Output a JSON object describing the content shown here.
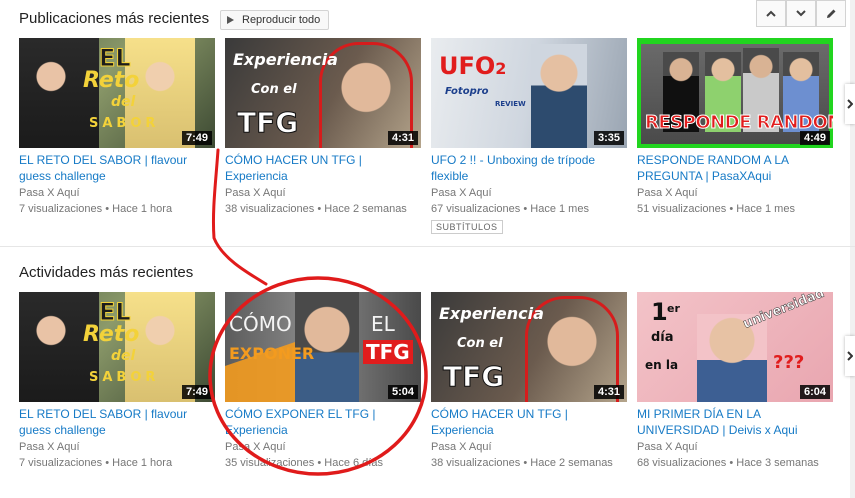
{
  "sections": {
    "recent_uploads": {
      "title": "Publicaciones más recientes",
      "play_all_label": "Reproducir todo"
    },
    "recent_activity": {
      "title": "Actividades más recientes"
    }
  },
  "controls": {
    "up_icon": "chevron-up-icon",
    "down_icon": "chevron-down-icon",
    "edit_icon": "pencil-icon"
  },
  "uploads": [
    {
      "title": "EL RETO DEL SABOR | flavour guess challenge",
      "channel": "Pasa X Aquí",
      "views": "7 visualizaciones",
      "age": "Hace 1 hora",
      "duration": "7:49",
      "thumb_text": [
        "EL",
        "Reto",
        "del",
        "SABOR"
      ]
    },
    {
      "title": "CÓMO HACER UN TFG | Experiencia",
      "channel": "Pasa X Aquí",
      "views": "38 visualizaciones",
      "age": "Hace 2 semanas",
      "duration": "4:31",
      "thumb_text": [
        "Experiencia",
        "Con el",
        "TFG"
      ]
    },
    {
      "title": "UFO 2 !! - Unboxing de trípode flexible",
      "channel": "Pasa X Aquí",
      "views": "67 visualizaciones",
      "age": "Hace 1 mes",
      "duration": "3:35",
      "badge": "SUBTÍTULOS",
      "thumb_text": [
        "UFO",
        "2",
        "Fotopro",
        "REVIEW"
      ]
    },
    {
      "title": "RESPONDE RANDOM A LA PREGUNTA | PasaXAqui",
      "channel": "Pasa X Aquí",
      "views": "51 visualizaciones",
      "age": "Hace 1 mes",
      "duration": "4:49",
      "thumb_text": [
        "RESPONDE RANDOM"
      ]
    }
  ],
  "activity": [
    {
      "title": "EL RETO DEL SABOR | flavour guess challenge",
      "channel": "Pasa X Aquí",
      "views": "7 visualizaciones",
      "age": "Hace 1 hora",
      "duration": "7:49",
      "thumb_text": [
        "EL",
        "Reto",
        "del",
        "SABOR"
      ]
    },
    {
      "title": "CÓMO EXPONER EL TFG | Experiencia",
      "channel": "Pasa X Aquí",
      "views": "35 visualizaciones",
      "age": "Hace 6 días",
      "duration": "5:04",
      "thumb_text": [
        "CÓMO",
        "EL",
        "EXPONER",
        "TFG"
      ]
    },
    {
      "title": "CÓMO HACER UN TFG | Experiencia",
      "channel": "Pasa X Aquí",
      "views": "38 visualizaciones",
      "age": "Hace 2 semanas",
      "duration": "4:31",
      "thumb_text": [
        "Experiencia",
        "Con el",
        "TFG"
      ]
    },
    {
      "title": "MI PRIMER DÍA EN LA UNIVERSIDAD | Deivis x Aqui",
      "channel": "Pasa X Aquí",
      "views": "68 visualizaciones",
      "age": "Hace 3 semanas",
      "duration": "6:04",
      "thumb_text": [
        "1",
        "er",
        "día",
        "en la",
        "universidad",
        "???"
      ]
    }
  ],
  "meta_separator": "•",
  "next_arrow_icon": "chevron-right-icon",
  "colors": {
    "link": "#167ac6",
    "annotation": "#e01b1b"
  }
}
